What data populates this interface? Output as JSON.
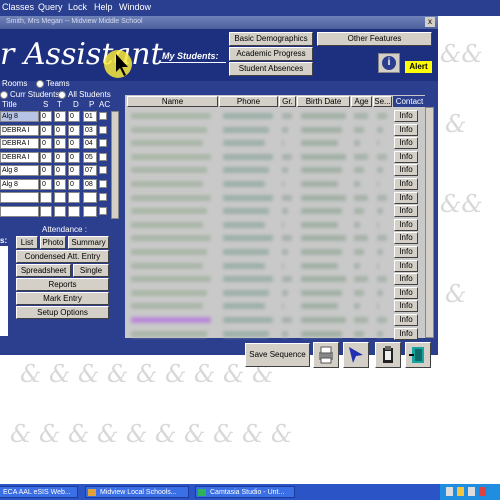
{
  "menubar": {
    "items": [
      "Classes",
      "Query",
      "Lock",
      "Help",
      "Window"
    ]
  },
  "window": {
    "title": "Smith, Mrs Megan -- Midview Middle School",
    "close_label": "x",
    "brand": "r Assistant",
    "my_students_label": "My Students:",
    "buttons": {
      "basic_demographics": "Basic Demographics",
      "academic_progress": "Academic Progress",
      "student_absences": "Student Absences",
      "other_features": "Other Features",
      "alert": "Alert"
    }
  },
  "left_panel": {
    "rooms_label": "Rooms",
    "teams_label": "Teams",
    "curr_students_label": "Curr Students",
    "all_students_label": "All Students",
    "columns": [
      "Title",
      "S",
      "T",
      "D",
      "P",
      "AC"
    ],
    "rows": [
      {
        "title": "Alg 8",
        "s": "0",
        "t": "0",
        "d": "0",
        "p": "01"
      },
      {
        "title": "DEBRA I",
        "s": "0",
        "t": "0",
        "d": "0",
        "p": "03"
      },
      {
        "title": "DEBRA I",
        "s": "0",
        "t": "0",
        "d": "0",
        "p": "04"
      },
      {
        "title": "DEBRA I",
        "s": "0",
        "t": "0",
        "d": "0",
        "p": "05"
      },
      {
        "title": "Alg 8",
        "s": "0",
        "t": "0",
        "d": "0",
        "p": "07"
      },
      {
        "title": "Alg 8",
        "s": "0",
        "t": "0",
        "d": "0",
        "p": "08"
      }
    ],
    "attendance_label": "Attendance :",
    "s_label": "s:",
    "buttons": {
      "list": "List",
      "photo": "Photo",
      "summary": "Summary",
      "condensed": "Condensed Att. Entry",
      "spreadsheet": "Spreadsheet",
      "single": "Single",
      "reports": "Reports",
      "mark_entry": "Mark Entry",
      "setup_options": "Setup Options"
    }
  },
  "grid": {
    "columns": [
      "Name",
      "Phone",
      "Gr.",
      "Birth Date",
      "Age",
      "Se...",
      "Contact"
    ],
    "info_label": "Info",
    "info_count": 17
  },
  "bottom": {
    "save_sequence": "Save Sequence"
  },
  "taskbar": {
    "items": [
      "ECA AAL eSIS Web...",
      "Midview Local Schools...",
      "Camtasia Studio - Unt..."
    ]
  },
  "colors": {
    "window_bg": "#2c3f8f",
    "header_bg": "#1d2f7f",
    "alert": "#ffff00",
    "taskbar": "#2b55c7"
  }
}
